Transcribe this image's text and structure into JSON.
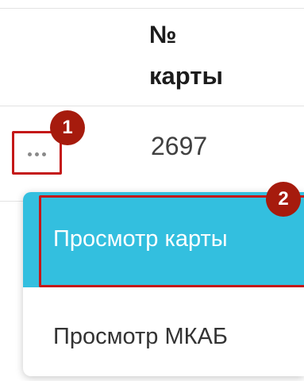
{
  "table": {
    "column_header_line1": "№",
    "column_header_line2": "карты",
    "row": {
      "card_number": "2697"
    }
  },
  "annotations": {
    "step1": "1",
    "step2": "2",
    "frame_color": "#c41818",
    "badge_color": "#a61b0d"
  },
  "menu": {
    "actions_icon": "more-horizontal-icon",
    "items": [
      {
        "label": "Просмотр карты",
        "active": true
      },
      {
        "label": "Просмотр МКАБ",
        "active": false
      }
    ],
    "active_color": "#33bfdf"
  }
}
